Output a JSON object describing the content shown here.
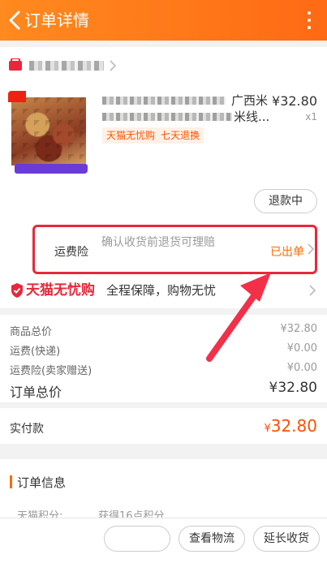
{
  "header": {
    "title": "订单详情"
  },
  "product": {
    "title_fragment_1": "广西米",
    "title_fragment_2": "米线...",
    "price": "¥32.80",
    "quantity": "x1",
    "tags": [
      "天猫无忧购",
      "七天退换"
    ],
    "status_button": "退款中"
  },
  "shipping_insurance": {
    "label": "运费险",
    "description": "确认收货前退货可理赔",
    "status": "已出单"
  },
  "tmall_assurance": {
    "logo_text": "天猫无忧购",
    "text": "全程保障，购物无忧"
  },
  "summary": {
    "rows": [
      {
        "label": "商品总价",
        "value": "¥32.80"
      },
      {
        "label": "运费(快递)",
        "value": "¥0.00"
      },
      {
        "label": "运费险(卖家赠送)",
        "value": "¥0.00"
      }
    ],
    "total_label": "订单总价",
    "total_value": "¥32.80",
    "paid_label": "实付款",
    "paid_currency": "¥",
    "paid_value": "32.80"
  },
  "order_info": {
    "title": "订单信息",
    "row_label": "天猫积分:",
    "row_value": "获得16点积分"
  },
  "bottom_actions": {
    "logistics": "查看物流",
    "extend": "延长收货"
  },
  "colors": {
    "header": "#ff7a1a",
    "accent": "#ff5000",
    "highlight": "#e8283a"
  }
}
